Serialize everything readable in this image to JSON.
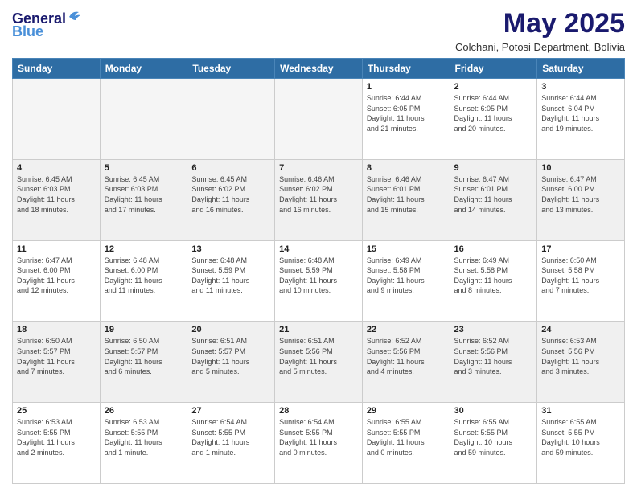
{
  "logo": {
    "line1": "General",
    "line2": "Blue"
  },
  "title": "May 2025",
  "location": "Colchani, Potosi Department, Bolivia",
  "headers": [
    "Sunday",
    "Monday",
    "Tuesday",
    "Wednesday",
    "Thursday",
    "Friday",
    "Saturday"
  ],
  "weeks": [
    [
      {
        "day": "",
        "info": ""
      },
      {
        "day": "",
        "info": ""
      },
      {
        "day": "",
        "info": ""
      },
      {
        "day": "",
        "info": ""
      },
      {
        "day": "1",
        "info": "Sunrise: 6:44 AM\nSunset: 6:05 PM\nDaylight: 11 hours\nand 21 minutes."
      },
      {
        "day": "2",
        "info": "Sunrise: 6:44 AM\nSunset: 6:05 PM\nDaylight: 11 hours\nand 20 minutes."
      },
      {
        "day": "3",
        "info": "Sunrise: 6:44 AM\nSunset: 6:04 PM\nDaylight: 11 hours\nand 19 minutes."
      }
    ],
    [
      {
        "day": "4",
        "info": "Sunrise: 6:45 AM\nSunset: 6:03 PM\nDaylight: 11 hours\nand 18 minutes."
      },
      {
        "day": "5",
        "info": "Sunrise: 6:45 AM\nSunset: 6:03 PM\nDaylight: 11 hours\nand 17 minutes."
      },
      {
        "day": "6",
        "info": "Sunrise: 6:45 AM\nSunset: 6:02 PM\nDaylight: 11 hours\nand 16 minutes."
      },
      {
        "day": "7",
        "info": "Sunrise: 6:46 AM\nSunset: 6:02 PM\nDaylight: 11 hours\nand 16 minutes."
      },
      {
        "day": "8",
        "info": "Sunrise: 6:46 AM\nSunset: 6:01 PM\nDaylight: 11 hours\nand 15 minutes."
      },
      {
        "day": "9",
        "info": "Sunrise: 6:47 AM\nSunset: 6:01 PM\nDaylight: 11 hours\nand 14 minutes."
      },
      {
        "day": "10",
        "info": "Sunrise: 6:47 AM\nSunset: 6:00 PM\nDaylight: 11 hours\nand 13 minutes."
      }
    ],
    [
      {
        "day": "11",
        "info": "Sunrise: 6:47 AM\nSunset: 6:00 PM\nDaylight: 11 hours\nand 12 minutes."
      },
      {
        "day": "12",
        "info": "Sunrise: 6:48 AM\nSunset: 6:00 PM\nDaylight: 11 hours\nand 11 minutes."
      },
      {
        "day": "13",
        "info": "Sunrise: 6:48 AM\nSunset: 5:59 PM\nDaylight: 11 hours\nand 11 minutes."
      },
      {
        "day": "14",
        "info": "Sunrise: 6:48 AM\nSunset: 5:59 PM\nDaylight: 11 hours\nand 10 minutes."
      },
      {
        "day": "15",
        "info": "Sunrise: 6:49 AM\nSunset: 5:58 PM\nDaylight: 11 hours\nand 9 minutes."
      },
      {
        "day": "16",
        "info": "Sunrise: 6:49 AM\nSunset: 5:58 PM\nDaylight: 11 hours\nand 8 minutes."
      },
      {
        "day": "17",
        "info": "Sunrise: 6:50 AM\nSunset: 5:58 PM\nDaylight: 11 hours\nand 7 minutes."
      }
    ],
    [
      {
        "day": "18",
        "info": "Sunrise: 6:50 AM\nSunset: 5:57 PM\nDaylight: 11 hours\nand 7 minutes."
      },
      {
        "day": "19",
        "info": "Sunrise: 6:50 AM\nSunset: 5:57 PM\nDaylight: 11 hours\nand 6 minutes."
      },
      {
        "day": "20",
        "info": "Sunrise: 6:51 AM\nSunset: 5:57 PM\nDaylight: 11 hours\nand 5 minutes."
      },
      {
        "day": "21",
        "info": "Sunrise: 6:51 AM\nSunset: 5:56 PM\nDaylight: 11 hours\nand 5 minutes."
      },
      {
        "day": "22",
        "info": "Sunrise: 6:52 AM\nSunset: 5:56 PM\nDaylight: 11 hours\nand 4 minutes."
      },
      {
        "day": "23",
        "info": "Sunrise: 6:52 AM\nSunset: 5:56 PM\nDaylight: 11 hours\nand 3 minutes."
      },
      {
        "day": "24",
        "info": "Sunrise: 6:53 AM\nSunset: 5:56 PM\nDaylight: 11 hours\nand 3 minutes."
      }
    ],
    [
      {
        "day": "25",
        "info": "Sunrise: 6:53 AM\nSunset: 5:55 PM\nDaylight: 11 hours\nand 2 minutes."
      },
      {
        "day": "26",
        "info": "Sunrise: 6:53 AM\nSunset: 5:55 PM\nDaylight: 11 hours\nand 1 minute."
      },
      {
        "day": "27",
        "info": "Sunrise: 6:54 AM\nSunset: 5:55 PM\nDaylight: 11 hours\nand 1 minute."
      },
      {
        "day": "28",
        "info": "Sunrise: 6:54 AM\nSunset: 5:55 PM\nDaylight: 11 hours\nand 0 minutes."
      },
      {
        "day": "29",
        "info": "Sunrise: 6:55 AM\nSunset: 5:55 PM\nDaylight: 11 hours\nand 0 minutes."
      },
      {
        "day": "30",
        "info": "Sunrise: 6:55 AM\nSunset: 5:55 PM\nDaylight: 10 hours\nand 59 minutes."
      },
      {
        "day": "31",
        "info": "Sunrise: 6:55 AM\nSunset: 5:55 PM\nDaylight: 10 hours\nand 59 minutes."
      }
    ]
  ]
}
